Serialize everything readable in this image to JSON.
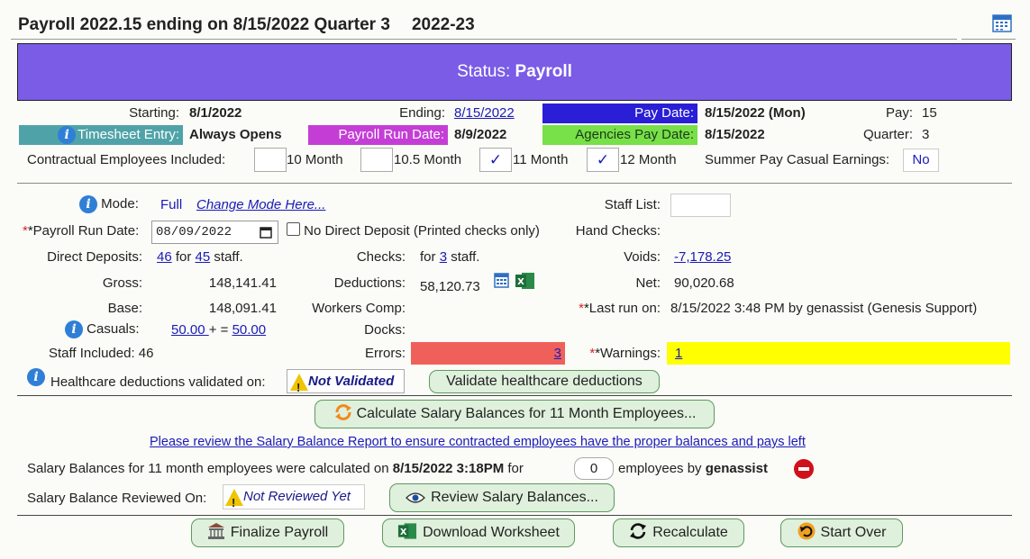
{
  "header": {
    "title": "Payroll 2022.15 ending on 8/15/2022 Quarter 3",
    "fiscal_year": "2022-23"
  },
  "status": {
    "label": "Status:",
    "value": "Payroll"
  },
  "dates": {
    "starting_label": "Starting:",
    "starting": "8/1/2022",
    "ending_label": "Ending:",
    "ending": "8/15/2022",
    "pay_date_label": "Pay Date:",
    "pay_date": "8/15/2022 (Mon)",
    "pay_label": "Pay:",
    "pay": "15",
    "timesheet_label": "Timesheet Entry:",
    "timesheet": "Always Opens",
    "run_date_label": "Payroll Run Date:",
    "run_date": "8/9/2022",
    "agencies_label": "Agencies Pay Date:",
    "agencies": "8/15/2022",
    "quarter_label": "Quarter:",
    "quarter": "3"
  },
  "contractual": {
    "label": "Contractual Employees Included:",
    "options": [
      {
        "label": "10 Month",
        "checked": ""
      },
      {
        "label": "10.5 Month",
        "checked": ""
      },
      {
        "label": "11 Month",
        "checked": "✓"
      },
      {
        "label": "12 Month",
        "checked": "✓"
      }
    ],
    "summer_label": "Summer Pay Casual Earnings:",
    "summer_value": "No"
  },
  "details": {
    "mode_label": "Mode:",
    "mode": "Full",
    "change_mode": "Change Mode Here...",
    "staff_list_label": "Staff List:",
    "run_date_label": "*Payroll Run Date:",
    "run_date_input": "08/09/2022",
    "no_dd_label": "No Direct Deposit (Printed checks only)",
    "hand_checks_label": "Hand Checks:",
    "dd_label": "Direct Deposits:",
    "dd_count": "46",
    "dd_for": "for",
    "dd_staff": "45",
    "dd_staff_suffix": "staff.",
    "checks_label": "Checks:",
    "checks_for": "for",
    "checks_count": "3",
    "checks_suffix": "staff.",
    "voids_label": "Voids:",
    "voids": "-7,178.25",
    "gross_label": "Gross:",
    "gross": "148,141.41",
    "deductions_label": "Deductions:",
    "deductions": "58,120.73",
    "net_label": "Net:",
    "net": "90,020.68",
    "base_label": "Base:",
    "base": "148,091.41",
    "workers_comp_label": "Workers Comp:",
    "last_run_label": "*Last run on:",
    "last_run": "8/15/2022 3:48 PM by genassist (Genesis Support)",
    "casuals_label": "Casuals:",
    "casuals_a": "50.00 ",
    "casuals_plus": "+ =",
    "casuals_b": "50.00",
    "docks_label": "Docks:",
    "staff_included_label": "Staff Included:",
    "staff_included": "46",
    "errors_label": "Errors:",
    "errors": "3",
    "warnings_label": "*Warnings:",
    "warnings": "1",
    "healthcare_label": "Healthcare deductions validated on:",
    "healthcare_status": "Not Validated",
    "validate_btn": "Validate healthcare deductions"
  },
  "salary": {
    "calc_btn": "Calculate Salary Balances for 11 Month Employees...",
    "review_link": "Please review the Salary Balance Report to ensure contracted employees have the proper balances and pays left",
    "calc_text_a": "Salary Balances for 11 month employees were calculated on",
    "calc_date": "8/15/2022 3:18PM",
    "calc_for": "for",
    "calc_count": "0",
    "calc_text_b": "employees by",
    "calc_user": "genassist",
    "reviewed_label": "Salary Balance Reviewed On:",
    "reviewed_status": "Not Reviewed Yet",
    "review_btn": "Review Salary Balances..."
  },
  "actions": {
    "finalize": "Finalize Payroll",
    "download": "Download Worksheet",
    "recalculate": "Recalculate",
    "start_over": "Start Over"
  },
  "colors": {
    "status_bg": "#7a5ce6",
    "pay_date_bg": "#2a1fd6",
    "timesheet_bg": "#4fa3a8",
    "run_date_bg": "#c43ed6",
    "agencies_bg": "#78e048",
    "errors_bg": "#f0605a",
    "warnings_bg": "#ffff00",
    "button_bg": "#dff0dc"
  }
}
